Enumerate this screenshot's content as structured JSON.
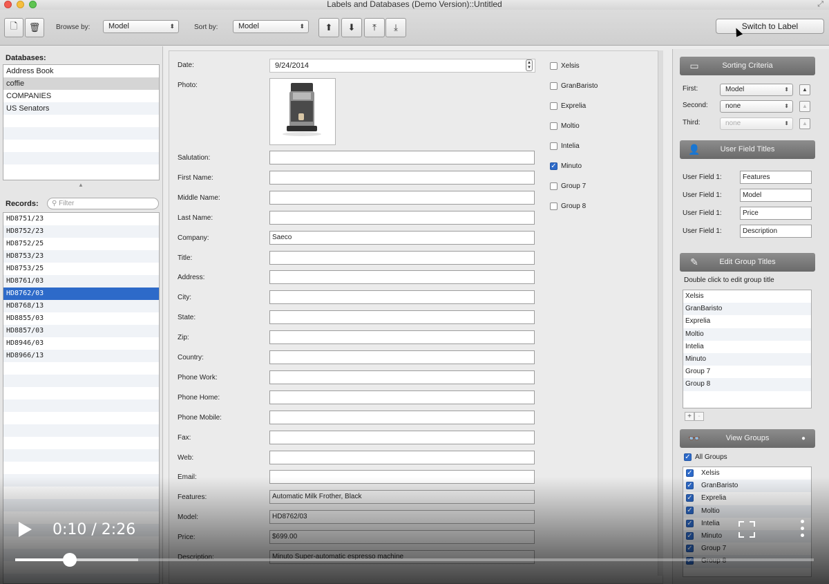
{
  "window": {
    "title": "Labels and Databases (Demo Version)::Untitled"
  },
  "toolbar": {
    "browse_label": "Browse by:",
    "browse_value": "Model",
    "sort_label": "Sort by:",
    "sort_value": "Model",
    "switch_button": "Switch to Label"
  },
  "databases": {
    "label": "Databases:",
    "items": [
      "Address Book",
      "coffie",
      "COMPANIES",
      "US Senators"
    ],
    "selected": "coffie"
  },
  "records": {
    "label": "Records:",
    "filter_placeholder": "Filter",
    "items": [
      "HD8751/23",
      "HD8752/23",
      "HD8752/25",
      "HD8753/23",
      "HD8753/25",
      "HD8761/03",
      "HD8762/03",
      "HD8768/13",
      "HD8855/03",
      "HD8857/03",
      "HD8946/03",
      "HD8966/13"
    ],
    "selected": "HD8762/03"
  },
  "form": {
    "date_label": "Date:",
    "date_value": "9/24/2014",
    "photo_label": "Photo:",
    "fields": [
      {
        "label": "Salutation:",
        "value": ""
      },
      {
        "label": "First Name:",
        "value": ""
      },
      {
        "label": "Middle Name:",
        "value": ""
      },
      {
        "label": "Last Name:",
        "value": ""
      },
      {
        "label": "Company:",
        "value": "Saeco"
      },
      {
        "label": "Title:",
        "value": ""
      },
      {
        "label": "Address:",
        "value": ""
      },
      {
        "label": "City:",
        "value": ""
      },
      {
        "label": "State:",
        "value": ""
      },
      {
        "label": "Zip:",
        "value": ""
      },
      {
        "label": "Country:",
        "value": ""
      },
      {
        "label": "Phone Work:",
        "value": ""
      },
      {
        "label": "Phone Home:",
        "value": ""
      },
      {
        "label": "Phone Mobile:",
        "value": ""
      },
      {
        "label": "Fax:",
        "value": ""
      },
      {
        "label": "Web:",
        "value": ""
      },
      {
        "label": "Email:",
        "value": ""
      },
      {
        "label": "Features:",
        "value": "Automatic Milk Frother, Black"
      },
      {
        "label": "Model:",
        "value": "HD8762/03"
      },
      {
        "label": "Price:",
        "value": "$699.00"
      },
      {
        "label": "Description:",
        "value": "Minuto Super-automatic espresso machine"
      }
    ],
    "groups": [
      {
        "label": "Xelsis",
        "checked": false
      },
      {
        "label": "GranBaristo",
        "checked": false
      },
      {
        "label": "Exprelia",
        "checked": false
      },
      {
        "label": "Moltio",
        "checked": false
      },
      {
        "label": "Intelia",
        "checked": false
      },
      {
        "label": "Minuto",
        "checked": true
      },
      {
        "label": "Group 7",
        "checked": false
      },
      {
        "label": "Group 8",
        "checked": false
      }
    ]
  },
  "sorting": {
    "title": "Sorting Criteria",
    "first_label": "First:",
    "first_value": "Model",
    "second_label": "Second:",
    "second_value": "none",
    "third_label": "Third:",
    "third_value": "none"
  },
  "user_fields": {
    "title": "User Field Titles",
    "items": [
      {
        "label": "User Field 1:",
        "value": "Features"
      },
      {
        "label": "User Field 1:",
        "value": "Model"
      },
      {
        "label": "User Field 1:",
        "value": "Price"
      },
      {
        "label": "User Field 1:",
        "value": "Description"
      }
    ]
  },
  "edit_groups": {
    "title": "Edit Group Titles",
    "hint": "Double click to edit group title",
    "items": [
      "Xelsis",
      "GranBaristo",
      "Exprelia",
      "Moltio",
      "Intelia",
      "Minuto",
      "Group 7",
      "Group 8"
    ],
    "add": "+",
    "remove": "-"
  },
  "view_groups": {
    "title": "View Groups",
    "all_label": "All Groups",
    "items": [
      "Xelsis",
      "GranBaristo",
      "Exprelia",
      "Moltio",
      "Intelia",
      "Minuto",
      "Group 7",
      "Group 8"
    ]
  },
  "video": {
    "time": "0:10 / 2:26",
    "progress": 0.068
  }
}
